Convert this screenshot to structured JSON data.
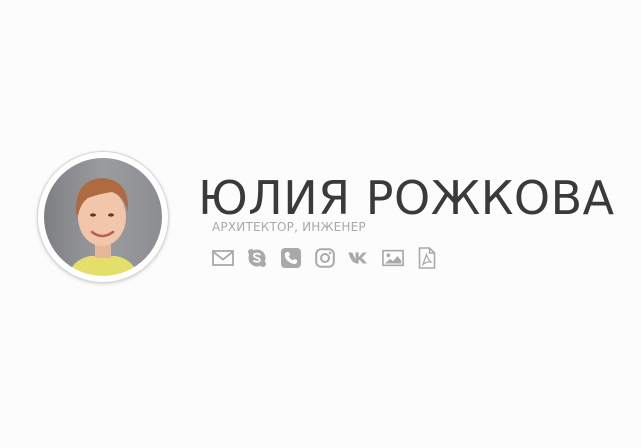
{
  "profile": {
    "name": "ЮЛИЯ РОЖКОВА",
    "title": "АРХИТЕКТОР, ИНЖЕНЕР"
  },
  "contacts": [
    {
      "icon": "email-icon"
    },
    {
      "icon": "skype-icon"
    },
    {
      "icon": "phone-icon"
    },
    {
      "icon": "instagram-icon"
    },
    {
      "icon": "vk-icon"
    },
    {
      "icon": "gallery-icon"
    },
    {
      "icon": "pdf-icon"
    }
  ],
  "colors": {
    "name": "#3a3a3a",
    "muted": "#a9a9a9",
    "background": "#fcfcfc"
  }
}
